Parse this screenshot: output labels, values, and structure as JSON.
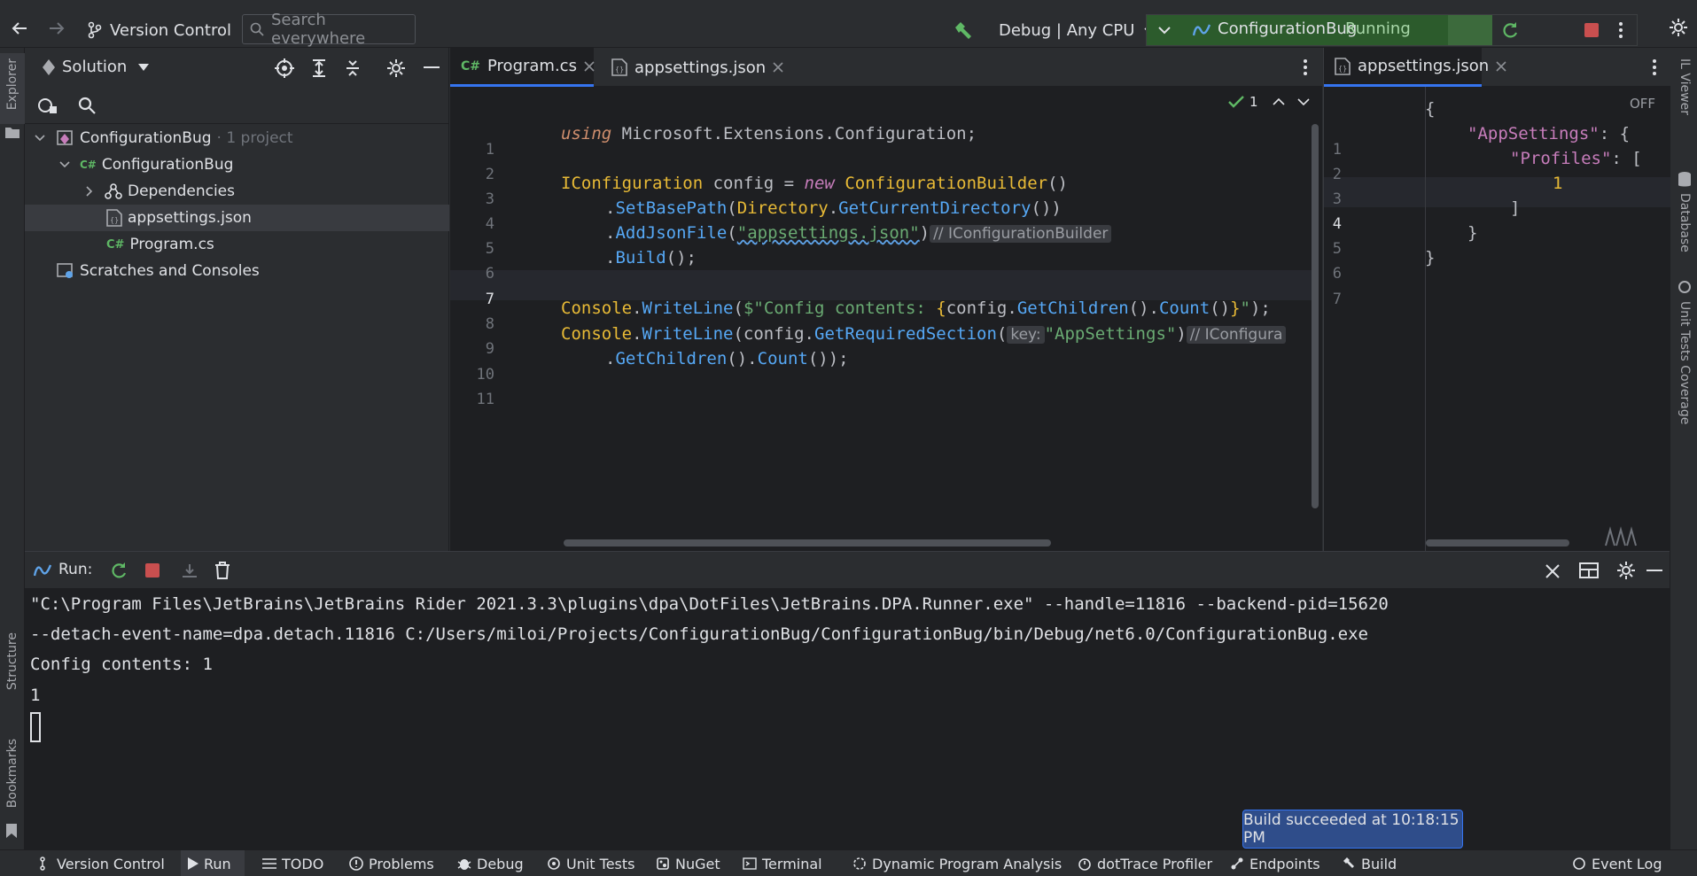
{
  "toolbar": {
    "version_control": "Version Control",
    "search_placeholder": "Search everywhere",
    "run_config": "Debug | Any CPU",
    "project": "ConfigurationBug",
    "status": "Running"
  },
  "explorer": {
    "title": "Solution",
    "tree": [
      {
        "label": "ConfigurationBug",
        "suffix": "· 1 project"
      },
      {
        "label": "ConfigurationBug"
      },
      {
        "label": "Dependencies"
      },
      {
        "label": "appsettings.json"
      },
      {
        "label": "Program.cs"
      },
      {
        "label": "Scratches and Consoles"
      }
    ]
  },
  "editor1": {
    "tabs": [
      "Program.cs",
      "appsettings.json"
    ],
    "inspection_count": "1",
    "line_numbers": [
      "1",
      "2",
      "3",
      "4",
      "5",
      "6",
      "7",
      "8",
      "9",
      "10",
      "11"
    ],
    "code": {
      "l2_kw": "using",
      "l2_rest": " Microsoft.Extensions.Configuration;",
      "l4_type": "IConfiguration",
      "l4_mid": " config = ",
      "l4_new": "new",
      "l4_builder": " ConfigurationBuilder",
      "l4_end": "()",
      "l5_dot": ".",
      "l5_m": "SetBasePath",
      "l5_p": "(",
      "l5_dir": "Directory",
      "l5_dot2": ".",
      "l5_m2": "GetCurrentDirectory",
      "l5_end": "())",
      "l6_dot": ".",
      "l6_m": "AddJsonFile",
      "l6_p": "(",
      "l6_str": "\"appsettings.json\"",
      "l6_end": ")",
      "l6_hint": "// IConfigurationBuilder",
      "l7_dot": ".",
      "l7_m": "Build",
      "l7_end": "();",
      "l9_c": "Console",
      "l9_dot": ".",
      "l9_m": "WriteLine",
      "l9_p": "(",
      "l9_str1": "$\"Config contents: ",
      "l9_b1": "{",
      "l9_expr1": "config.",
      "l9_m2": "GetChildren",
      "l9_expr2": "().",
      "l9_m3": "Count",
      "l9_expr3": "()",
      "l9_b2": "}",
      "l9_str2": "\"",
      "l9_end": ");",
      "l10_c": "Console",
      "l10_dot": ".",
      "l10_m": "WriteLine",
      "l10_p": "(config.",
      "l10_m2": "GetRequiredSection",
      "l10_p2": "(",
      "l10_key": "key:",
      "l10_str": "\"AppSettings\"",
      "l10_end": ")",
      "l10_hint": "// IConfigura",
      "l11_dot": ".",
      "l11_m": "GetChildren",
      "l11_mid": "().",
      "l11_m2": "Count",
      "l11_end": "());"
    }
  },
  "editor2": {
    "tab": "appsettings.json",
    "off_label": "OFF",
    "line_numbers": [
      "1",
      "2",
      "3",
      "4",
      "5",
      "6",
      "7"
    ],
    "lines": [
      "{",
      "\"AppSettings\"",
      ": {",
      "\"Profiles\"",
      ": [",
      "1",
      "]",
      "}",
      "}"
    ]
  },
  "run": {
    "label": "Run:",
    "output": [
      "\"C:\\Program Files\\JetBrains\\JetBrains Rider 2021.3.3\\plugins\\dpa\\DotFiles\\JetBrains.DPA.Runner.exe\" --handle=11816 --backend-pid=15620",
      "--detach-event-name=dpa.detach.11816 C:/Users/miloi/Projects/ConfigurationBug/ConfigurationBug/bin/Debug/net6.0/ConfigurationBug.exe",
      "Config contents: 1",
      "1"
    ]
  },
  "left_strip": {
    "explorer": "Explorer",
    "structure": "Structure",
    "bookmarks": "Bookmarks"
  },
  "right_strip": {
    "il_viewer": "IL Viewer",
    "database": "Database",
    "unit_tests": "Unit Tests Coverage"
  },
  "bottom": {
    "items": [
      "Version Control",
      "Run",
      "TODO",
      "Problems",
      "Debug",
      "Unit Tests",
      "NuGet",
      "Terminal",
      "Dynamic Program Analysis",
      "dotTrace Profiler",
      "Endpoints",
      "Build",
      "Event Log"
    ]
  },
  "notification": "Build succeeded at 10:18:15 PM",
  "colors": {
    "accent": "#3574f0",
    "running_green": "#2c5b2c",
    "stop_red": "#c94f4f"
  }
}
